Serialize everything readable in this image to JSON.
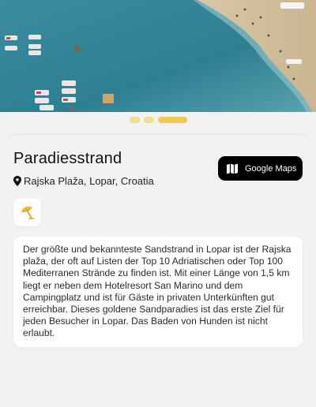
{
  "hero": {
    "image_alt_icon": "beach-aerial-photo"
  },
  "carousel": {
    "count": 3,
    "active_index": 2
  },
  "place": {
    "title": "Paradiesstrand",
    "location": "Rajska Plaža, Lopar, Croatia"
  },
  "maps_button": {
    "label": "Google Maps",
    "icon": "map-icon"
  },
  "amenities": [
    {
      "icon": "beach-umbrella-icon"
    }
  ],
  "description": " Der größte und bekannteste Sandstrand in Lopar ist der Rajska plaža, der oft auf Listen der Top 10 Adriatischen oder Top 100 Mediterranen Strände zu finden ist. Mit einer Länge von 1,5 km liegt er neben dem Hotelresort San Marino und dem Campingplatz und ist für Gäste in privaten Unterkünften gut erreichbar. Dieses goldene Sandparadies ist das erste Ziel für jeden Besucher in Lopar. Das Baden von Hunden ist nicht erlaubt.",
  "colors": {
    "accent": "#f0c94f",
    "accent_light": "#f3dc8f",
    "button_bg": "#000000",
    "sea": "#2f7f93"
  }
}
